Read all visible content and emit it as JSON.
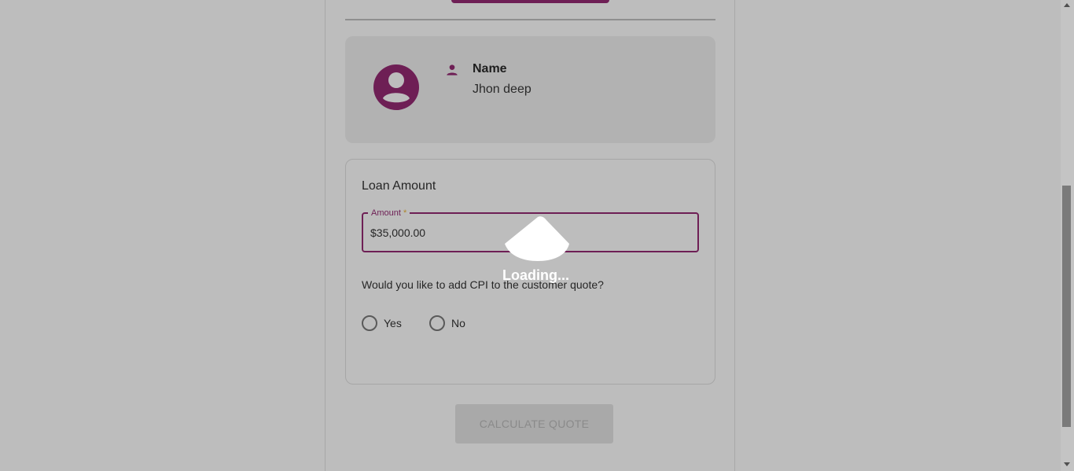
{
  "customer": {
    "name_label": "Name",
    "name_value": "Jhon deep"
  },
  "loan": {
    "title": "Loan Amount",
    "amount_label": "Amount",
    "amount_required_mark": "*",
    "amount_value": "$35,000.00",
    "cpi_question": "Would you like to add CPI to the customer quote?",
    "options": [
      {
        "label": "Yes",
        "selected": false
      },
      {
        "label": "No",
        "selected": false
      }
    ]
  },
  "actions": {
    "calculate_label": "CALCULATE QUOTE",
    "calculate_disabled": true
  },
  "loading": {
    "text": "Loading..."
  },
  "icons": {
    "avatar": "account-circle-icon",
    "person": "person-icon",
    "scroll_up": "arrow-up-icon",
    "scroll_down": "arrow-down-icon"
  },
  "colors": {
    "accent": "#6e1f55",
    "background": "#bdbdbd",
    "card": "#b2b2b2",
    "required": "#b0862a"
  }
}
